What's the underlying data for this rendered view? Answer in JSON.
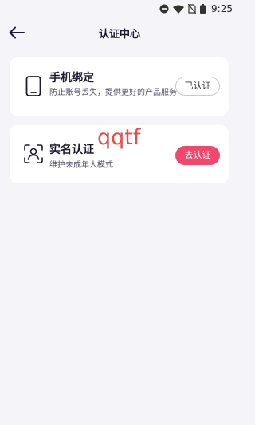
{
  "statusbar": {
    "time": "9:25",
    "icons": [
      "do-not-disturb-icon",
      "wifi-icon",
      "no-sim-icon",
      "battery-icon"
    ]
  },
  "navbar": {
    "title": "认证中心",
    "back_icon": "arrow-left-icon"
  },
  "cards": [
    {
      "icon": "phone-icon",
      "title": "手机绑定",
      "subtitle": "防止账号丢失，提供更好的产品服务",
      "button": "已认证"
    },
    {
      "icon": "face-id-icon",
      "title": "实名认证",
      "subtitle": "维护未成年人模式",
      "button": "去认证"
    }
  ],
  "overlay_text": "qqtf",
  "colors": {
    "background": "#f5f5f9",
    "card": "#ffffff",
    "accent": "#f1476c",
    "overlay": "#e84b4b"
  }
}
